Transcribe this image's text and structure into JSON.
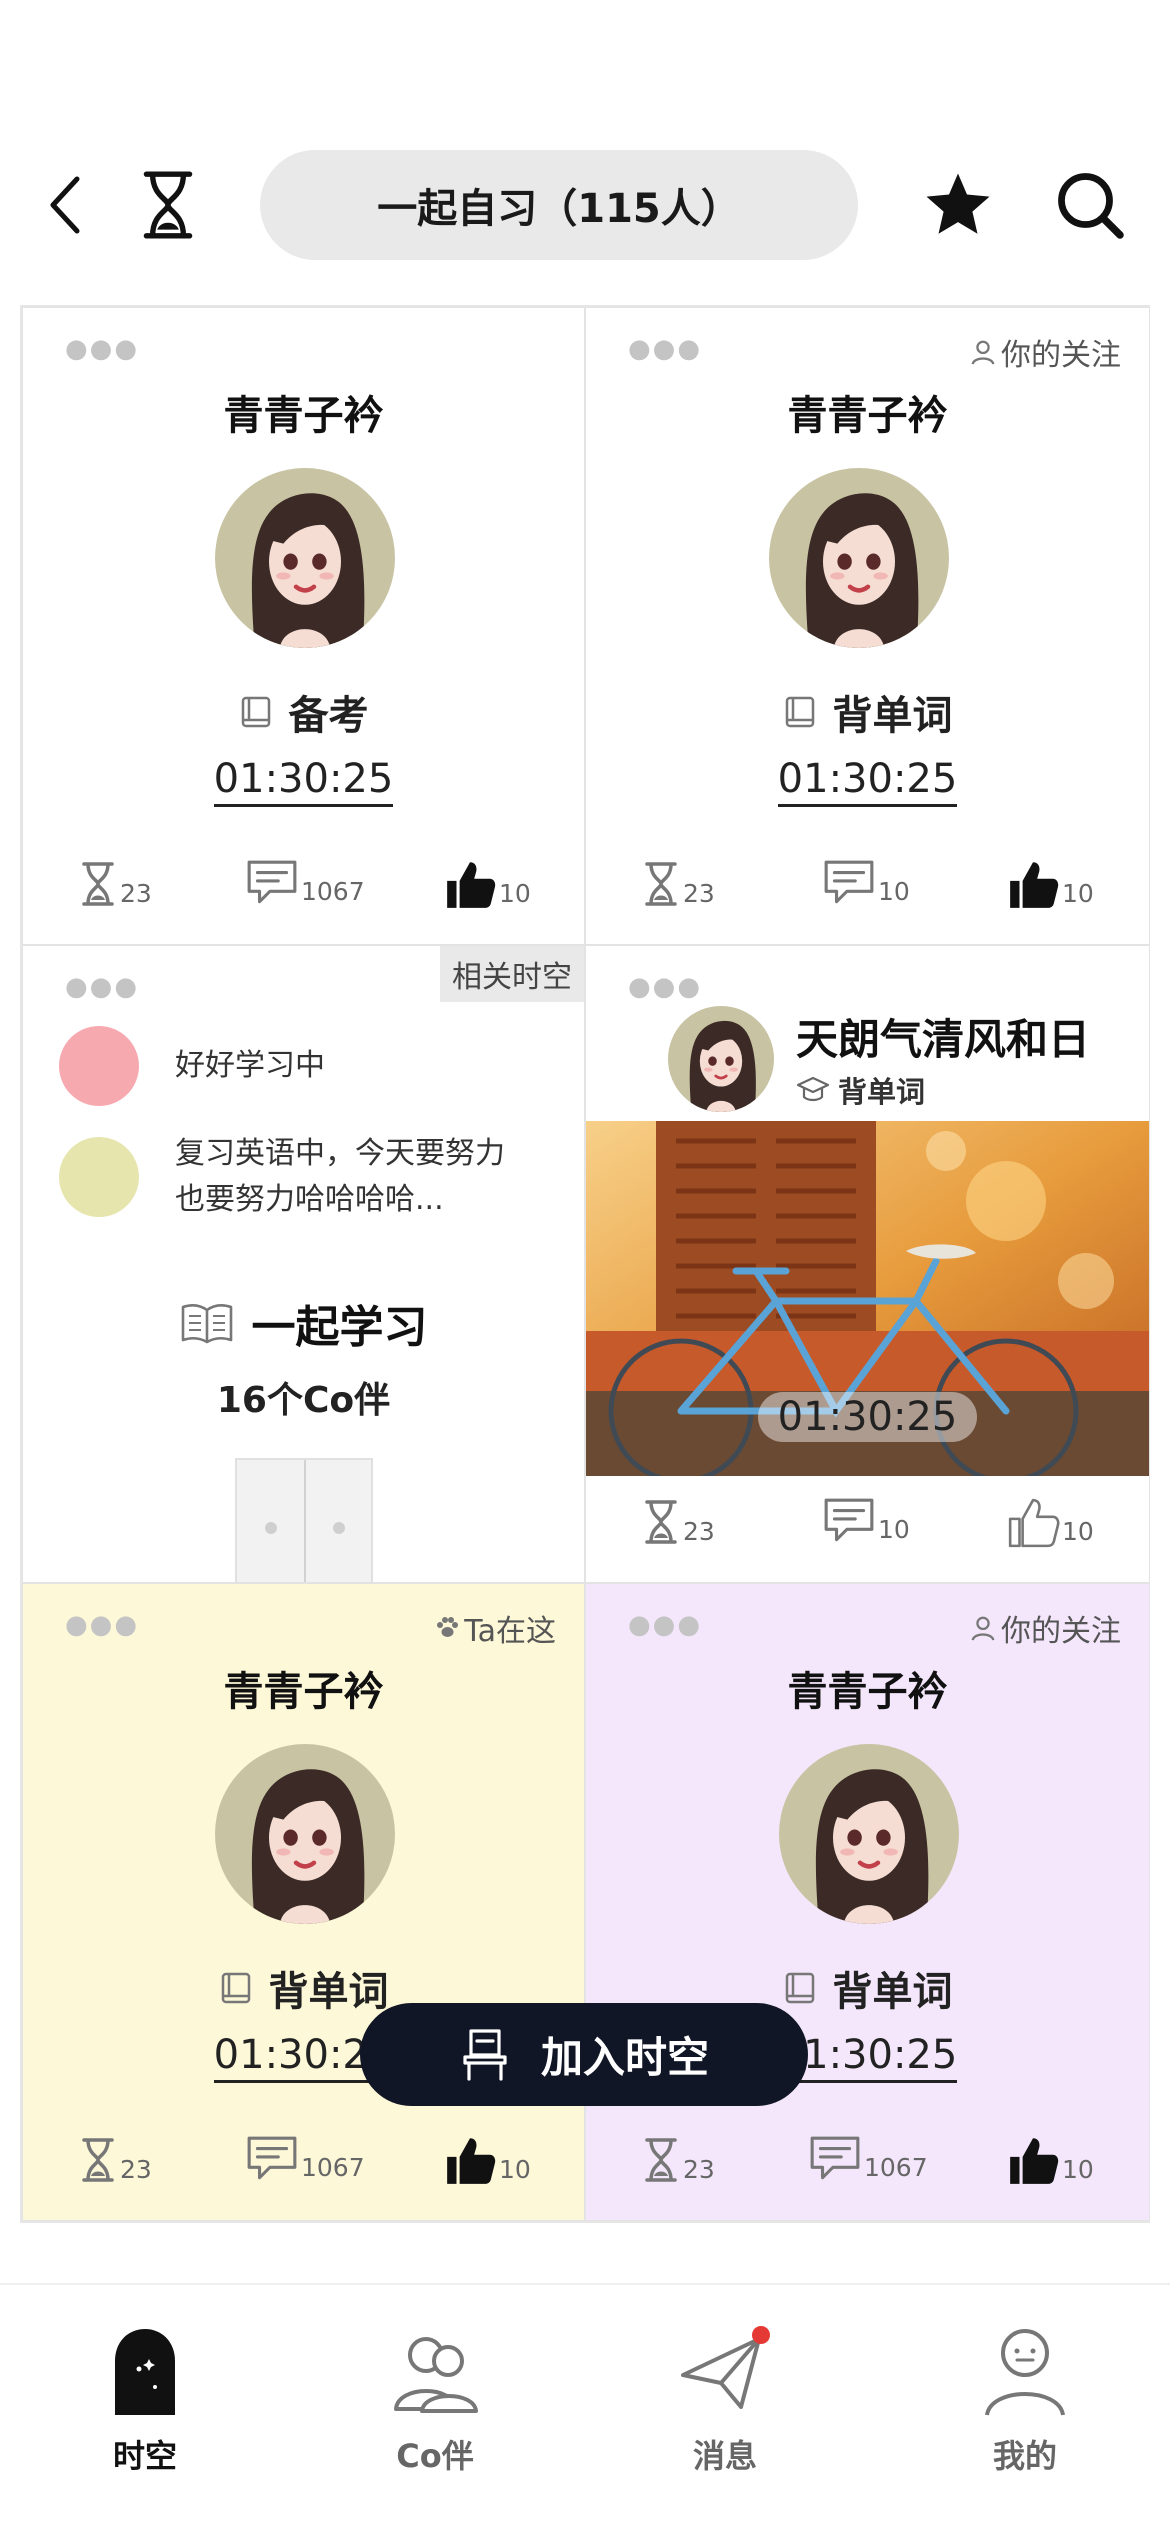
{
  "header": {
    "title": "一起自习（115人）",
    "back_icon": "chevron-left-icon",
    "timer_icon": "hourglass-icon",
    "favorite_icon": "star-icon",
    "search_icon": "search-icon"
  },
  "cards": [
    {
      "name": "青青子衿",
      "tag": "",
      "subject": "备考",
      "timer": "01:30:25",
      "stats": {
        "hourglass": "23",
        "comments": "1067",
        "likes": "10"
      },
      "background": "#ffffff"
    },
    {
      "name": "青青子衿",
      "tag": "你的关注",
      "subject": "背单词",
      "timer": "01:30:25",
      "stats": {
        "hourglass": "23",
        "comments": "10",
        "likes": "10"
      },
      "background": "#ffffff"
    },
    {
      "tag": "相关时空",
      "messages": [
        {
          "text": "好好学习中",
          "color": "#f7a9b0"
        },
        {
          "text": "复习英语中，今天要努力也要努力哈哈哈哈...",
          "color": "#e6e5ad"
        }
      ],
      "room_title": "一起学习",
      "room_count": "16个Co伴"
    },
    {
      "name": "天朗气清风和日",
      "subject": "背单词",
      "timer": "01:30:25",
      "stats": {
        "hourglass": "23",
        "comments": "10",
        "likes": "10"
      }
    },
    {
      "name": "青青子衿",
      "tag": "Ta在这",
      "subject": "背单词",
      "timer": "01:30:25",
      "stats": {
        "hourglass": "23",
        "comments": "1067",
        "likes": "10"
      },
      "background": "#fdf8d8"
    },
    {
      "name": "青青子衿",
      "tag": "你的关注",
      "subject": "背单词",
      "timer": "01:30:25",
      "stats": {
        "hourglass": "23",
        "comments": "1067",
        "likes": "10"
      },
      "background": "#f4e7fb"
    }
  ],
  "join_button": {
    "label": "加入时空"
  },
  "bottom_nav": {
    "items": [
      {
        "label": "时空",
        "icon": "portal-icon",
        "active": true
      },
      {
        "label": "Co伴",
        "icon": "companions-icon",
        "active": false
      },
      {
        "label": "消息",
        "icon": "paper-plane-icon",
        "active": false,
        "badge": true
      },
      {
        "label": "我的",
        "icon": "profile-icon",
        "active": false
      }
    ]
  },
  "colors": {
    "accent_dark": "#111626",
    "notification": "#e53935"
  }
}
